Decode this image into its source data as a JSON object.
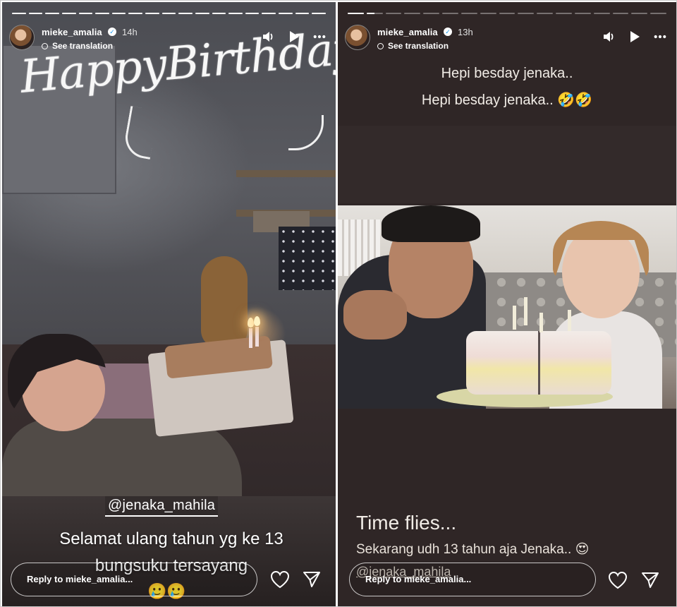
{
  "left_story": {
    "progress": [
      1.0,
      1.0,
      1.0,
      1.0,
      1.0,
      1.0,
      1.0,
      1.0,
      1.0,
      1.0,
      1.0,
      1.0,
      1.0,
      1.0,
      1.0,
      1.0,
      1.0,
      1.0,
      1.0
    ],
    "username": "mieke_amalia",
    "time": "14h",
    "see_translation": "See translation",
    "handwritten": "HappyBirthday!",
    "mention": "@jenaka_mahila",
    "caption": "Selamat ulang tahun yg ke 13 bungsuku tersayang",
    "emojis": "🥲🥲",
    "reply_placeholder": "Reply to mieke_amalia..."
  },
  "right_story": {
    "progress": [
      1.0,
      0.5,
      0,
      0,
      0,
      0,
      0,
      0,
      0,
      0,
      0,
      0,
      0,
      0,
      0,
      0,
      0
    ],
    "username": "mieke_amalia",
    "time": "13h",
    "see_translation": "See translation",
    "caption_line1": "Hepi besday jenaka..",
    "caption_line2": "Hepi besday jenaka.. 🤣🤣",
    "time_flies": "Time flies...",
    "sekarang": "Sekarang udh 13 tahun aja Jenaka.. 😍",
    "mention": "@jenaka_mahila",
    "reply_placeholder": "Reply to mieke_amalia..."
  },
  "icons": {
    "verified": "verified-badge-icon",
    "sound": "speaker-icon",
    "play": "play-icon",
    "more": "more-dots-icon",
    "like": "heart-icon",
    "send": "send-icon"
  }
}
